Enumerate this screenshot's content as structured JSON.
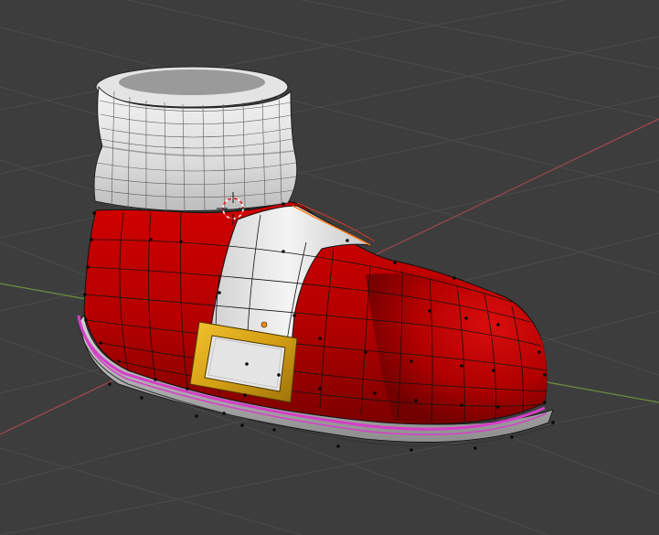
{
  "viewport": {
    "mode": "edit",
    "shading": "solid",
    "colors": {
      "background": "#3d3d3d",
      "grid": "#4a4a4a",
      "axis_x": "#9a4650",
      "axis_y": "#6f8a3f",
      "boot_red": "#b00000",
      "boot_red_dark": "#7a0000",
      "stripe_white": "#e8e8e8",
      "cuff_white": "#e6e6e6",
      "buckle_gold": "#d7a81c",
      "sole_gray": "#bdbdbd",
      "seam_magenta": "#d63ec8",
      "selected_edge": "#ff7a1a",
      "wire": "#111111",
      "vertex": "#0a0a0a",
      "origin": "#ff8c1a"
    },
    "objects": [
      {
        "name": "boot-mesh",
        "selected": true
      },
      {
        "name": "3d-cursor"
      }
    ]
  }
}
